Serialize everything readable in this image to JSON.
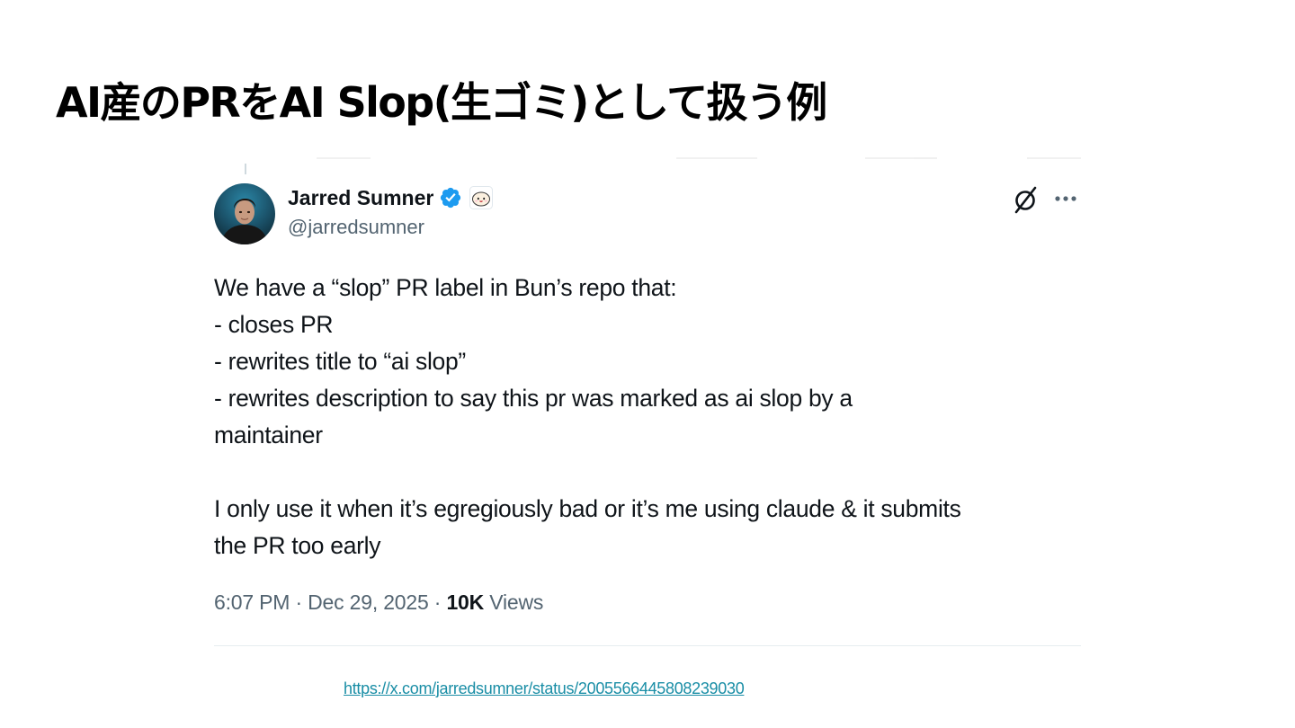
{
  "slide": {
    "title": "AI産のPRをAI Slop(生ゴミ)として扱う例"
  },
  "tweet": {
    "author": {
      "display_name": "Jarred Sumner",
      "handle": "@jarredsumner",
      "verified": true,
      "verified_color": "#1d9bf0",
      "profile_badge": "bun-logo-badge"
    },
    "body_lines": [
      "We have a “slop” PR label in Bun’s repo that:",
      "- closes PR",
      "- rewrites title to “ai slop”",
      "- rewrites description to say this pr was marked as ai slop by a",
      "maintainer",
      "",
      "I only use it when it’s egregiously bad or it’s me using claude & it submits",
      "the PR too early"
    ],
    "meta": {
      "time": "6:07 PM",
      "separator": "·",
      "date": "Dec 29, 2025",
      "views_count": "10K",
      "views_label": "Views"
    },
    "actions": {
      "grok_icon": "grok-icon",
      "more_icon": "more-icon"
    }
  },
  "source": {
    "url_text": "https://x.com/jarredsumner/status/2005566445808239030"
  },
  "colors": {
    "text_primary": "#0f1419",
    "text_secondary": "#536471",
    "link": "#1a8ea6",
    "verified": "#1d9bf0"
  }
}
